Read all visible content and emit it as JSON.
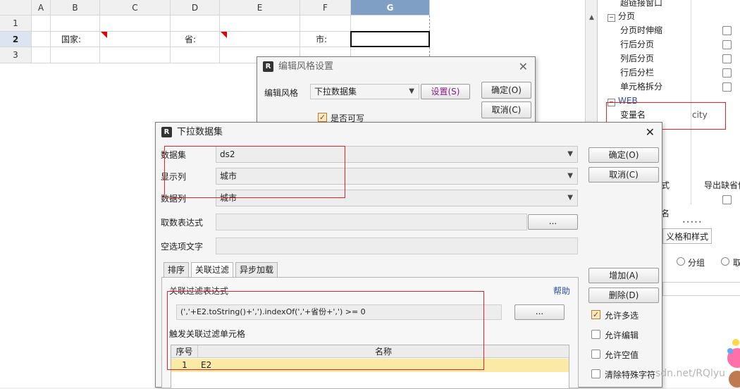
{
  "sheet": {
    "columns": [
      "A",
      "B",
      "C",
      "D",
      "E",
      "F",
      "G"
    ],
    "rows": [
      "1",
      "2",
      "3"
    ],
    "cells": {
      "B2": "国家:",
      "D2": "省:",
      "F2": "市:"
    }
  },
  "panel": {
    "items": [
      {
        "label": "超链接窗口",
        "indent": 1
      },
      {
        "label": "分页",
        "indent": 0,
        "section": true
      },
      {
        "label": "分页时伸缩",
        "indent": 1,
        "check": true
      },
      {
        "label": "行后分页",
        "indent": 1,
        "check": true
      },
      {
        "label": "列后分页",
        "indent": 1,
        "check": true
      },
      {
        "label": "行后分栏",
        "indent": 1,
        "check": true
      },
      {
        "label": "单元格拆分",
        "indent": 1,
        "check": true
      },
      {
        "label": "WEB",
        "indent": 0,
        "section": true
      },
      {
        "label": "变量名",
        "indent": 1,
        "value": "city"
      }
    ],
    "frag_style": "式",
    "frag_export": "导出缺省值",
    "frag_name": "名",
    "tab_label": "义格和样式",
    "radio_group": "分组",
    "radio_other": "取"
  },
  "style_dialog": {
    "title": "编辑风格设置",
    "label": "编辑风格",
    "combo": "下拉数据集",
    "settings_button": "设置(S)",
    "ok": "确定(O)",
    "cancel": "取消(C)",
    "writable": "是否可写"
  },
  "ds_dialog": {
    "title": "下拉数据集",
    "dataset_label": "数据集",
    "dataset_value": "ds2",
    "display_label": "显示列",
    "display_value": "城市",
    "data_label": "数据列",
    "data_value": "城市",
    "expr_label": "取数表达式",
    "empty_label": "空选项文字",
    "browse": "...",
    "tabs": [
      "排序",
      "关联过滤",
      "异步加载"
    ],
    "filter_expr_label": "关联过滤表达式",
    "help": "帮助",
    "filter_expr": "(','+E2.toString()+',').indexOf(','+省份+',') >= 0",
    "trigger_label": "触发关联过滤单元格",
    "table_headers": [
      "序号",
      "名称"
    ],
    "table_rows": [
      {
        "no": "1",
        "name": "E2"
      }
    ],
    "ok": "确定(O)",
    "cancel": "取消(C)",
    "add": "增加(A)",
    "delete": "删除(D)",
    "options": [
      {
        "label": "允许多选",
        "checked": true
      },
      {
        "label": "允许编辑",
        "checked": false
      },
      {
        "label": "允许空值",
        "checked": false
      },
      {
        "label": "清除特殊字符",
        "checked": false
      }
    ]
  },
  "watermark": "sdn.net/RQlyu",
  "colors": {
    "accent": "#7f9fc4",
    "highlight_row": "#fbe9a6",
    "red_box": "#e0242b"
  }
}
